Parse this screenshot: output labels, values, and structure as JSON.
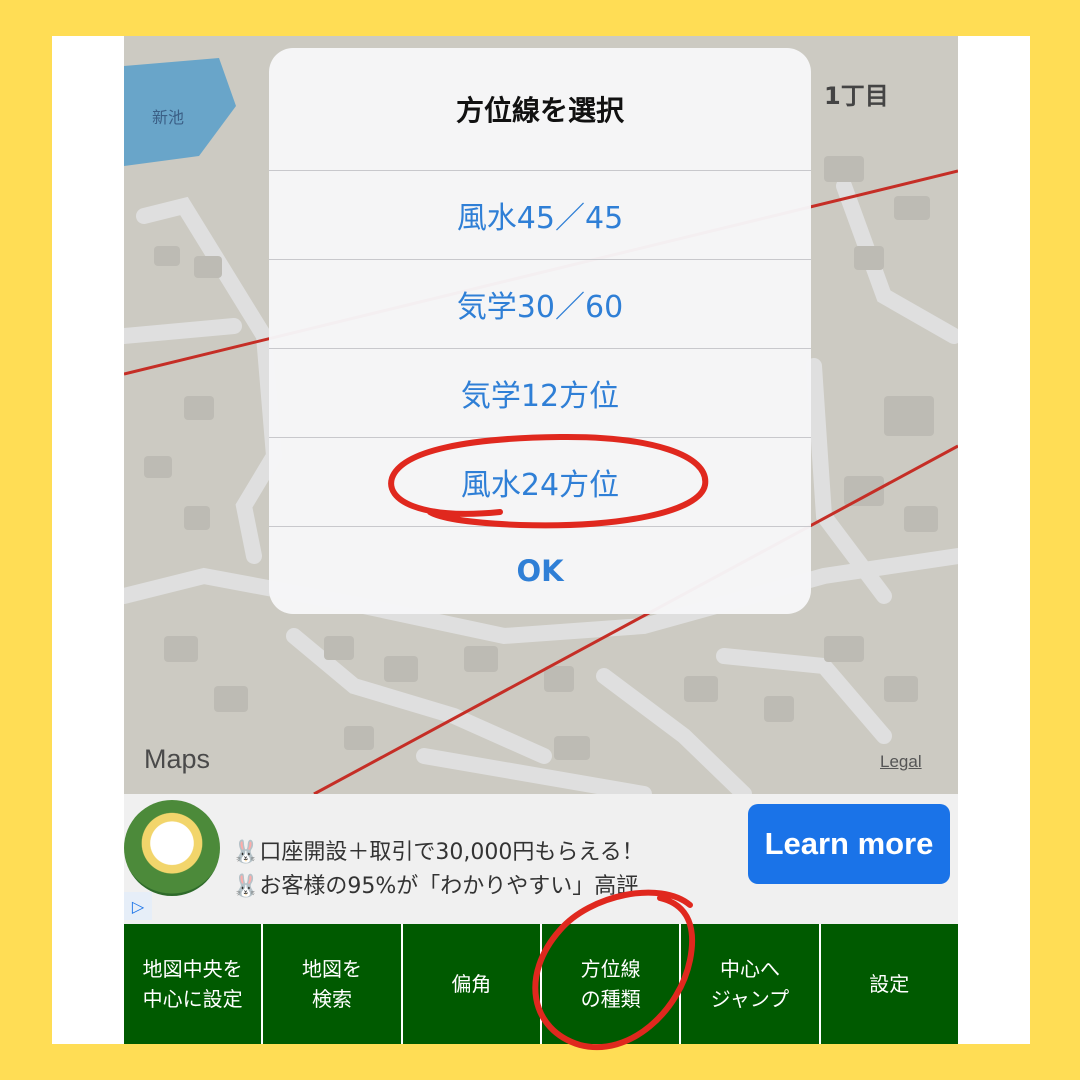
{
  "map": {
    "pond_label": "新池",
    "district_label": "1丁目",
    "attribution": "Maps",
    "legal": "Legal"
  },
  "dialog": {
    "title": "方位線を選択",
    "options": [
      "風水45／45",
      "気学30／60",
      "気学12方位",
      "風水24方位"
    ],
    "ok": "OK"
  },
  "ad": {
    "line1": "🐰口座開設＋取引で30,000円もらえる！",
    "line2": "🐰お客様の95%が「わかりやすい」高評",
    "cta": "Learn more"
  },
  "toolbar": {
    "items": [
      "地図中央を\n中心に設定",
      "地図を\n検索",
      "偏角",
      "方位線\nの種類",
      "中心へ\nジャンプ",
      "設定"
    ]
  },
  "colors": {
    "accent_blue": "#2f7fd6",
    "toolbar_green": "#005a00",
    "highlight_red": "#e0281e",
    "frame_yellow": "#ffdd55"
  }
}
